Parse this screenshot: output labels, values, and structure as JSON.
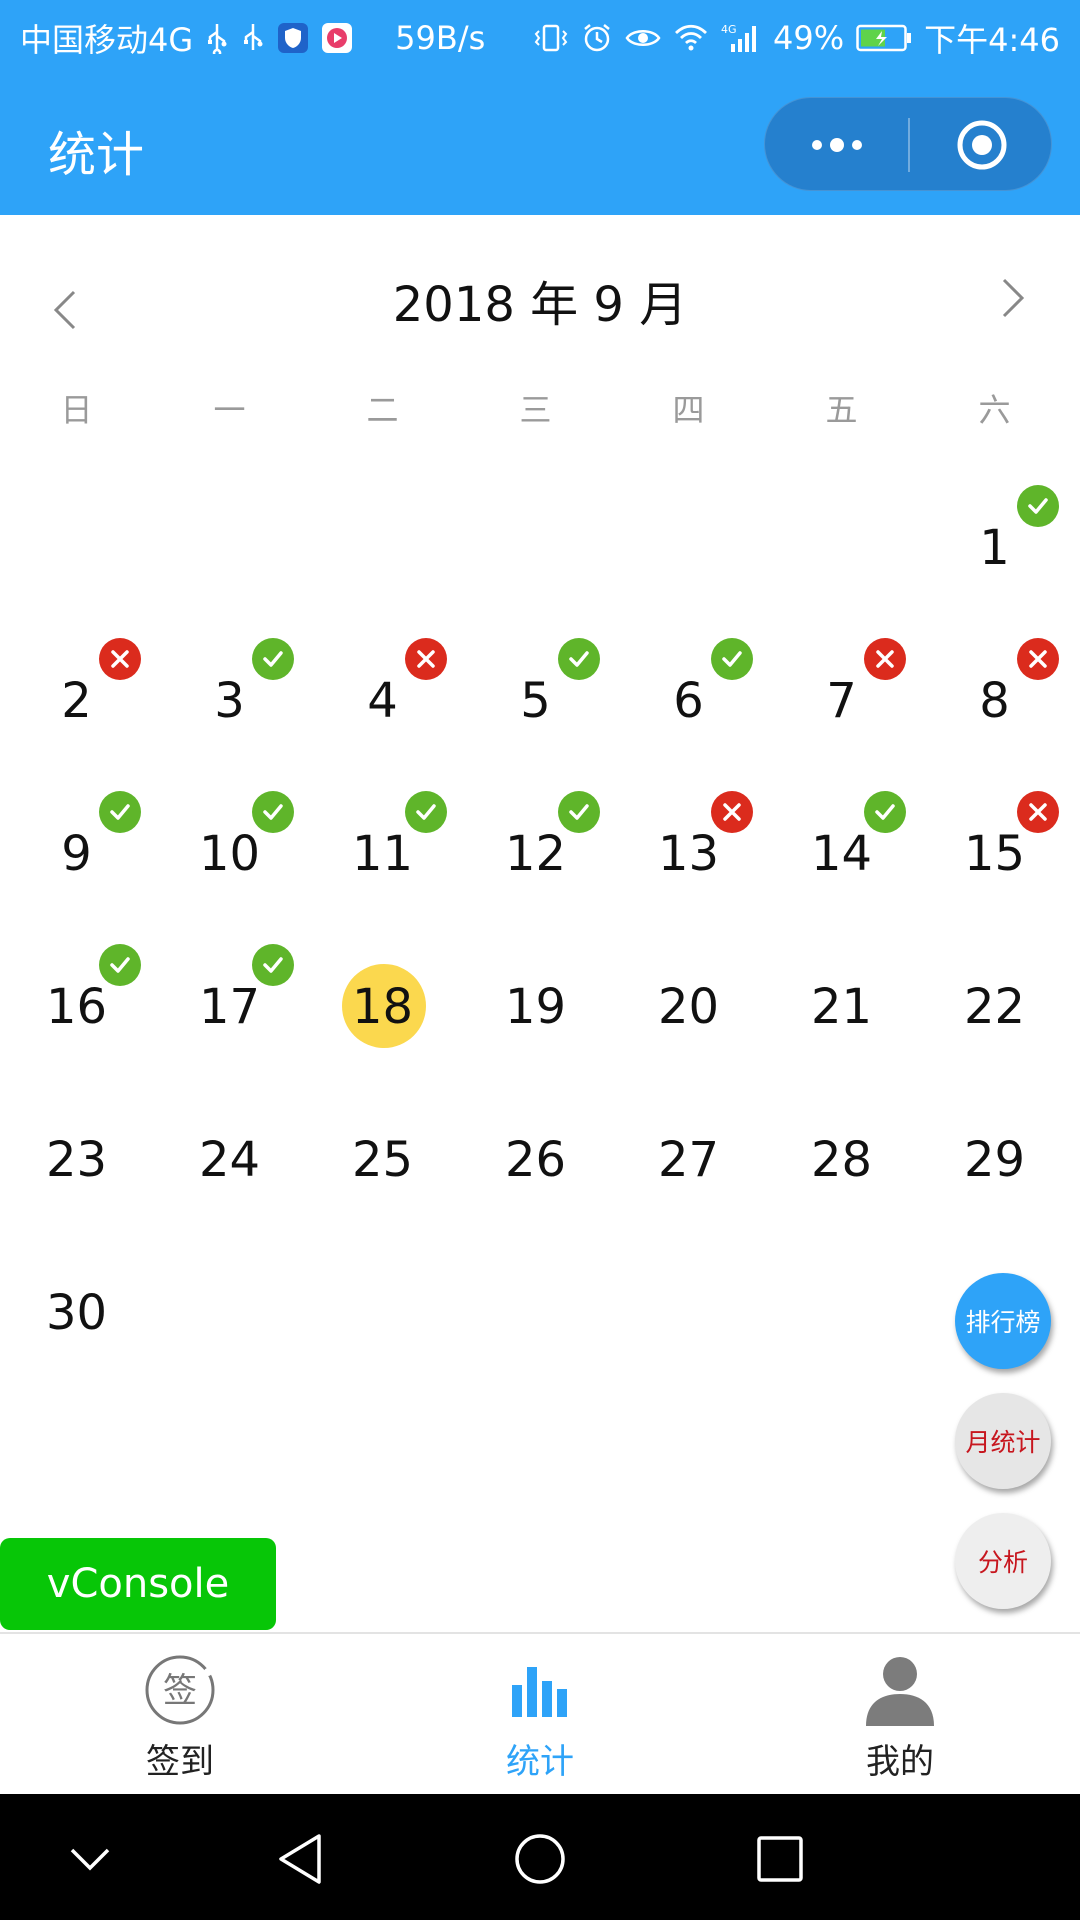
{
  "status_bar": {
    "carrier": "中国移动4G",
    "speed": "59B/s",
    "battery": "49%",
    "time": "下午4:46",
    "network_tag": "4G"
  },
  "navbar": {
    "title": "统计"
  },
  "calendar": {
    "month_title": "2018 年 9 月",
    "weekdays": [
      "日",
      "一",
      "二",
      "三",
      "四",
      "五",
      "六"
    ],
    "today": 18,
    "days": [
      {
        "d": "1",
        "s": "ok"
      },
      {
        "d": "2",
        "s": "miss"
      },
      {
        "d": "3",
        "s": "ok"
      },
      {
        "d": "4",
        "s": "miss"
      },
      {
        "d": "5",
        "s": "ok"
      },
      {
        "d": "6",
        "s": "ok"
      },
      {
        "d": "7",
        "s": "miss"
      },
      {
        "d": "8",
        "s": "miss"
      },
      {
        "d": "9",
        "s": "ok"
      },
      {
        "d": "10",
        "s": "ok"
      },
      {
        "d": "11",
        "s": "ok"
      },
      {
        "d": "12",
        "s": "ok"
      },
      {
        "d": "13",
        "s": "miss"
      },
      {
        "d": "14",
        "s": "ok"
      },
      {
        "d": "15",
        "s": "miss"
      },
      {
        "d": "16",
        "s": "ok"
      },
      {
        "d": "17",
        "s": "ok"
      },
      {
        "d": "18",
        "s": "today"
      },
      {
        "d": "19",
        "s": ""
      },
      {
        "d": "20",
        "s": ""
      },
      {
        "d": "21",
        "s": ""
      },
      {
        "d": "22",
        "s": ""
      },
      {
        "d": "23",
        "s": ""
      },
      {
        "d": "24",
        "s": ""
      },
      {
        "d": "25",
        "s": ""
      },
      {
        "d": "26",
        "s": ""
      },
      {
        "d": "27",
        "s": ""
      },
      {
        "d": "28",
        "s": ""
      },
      {
        "d": "29",
        "s": ""
      },
      {
        "d": "30",
        "s": ""
      }
    ]
  },
  "fabs": {
    "rank": "排行榜",
    "monthly": "月统计",
    "analysis": "分析"
  },
  "vconsole": "vConsole",
  "tabbar": {
    "items": [
      {
        "label": "签到",
        "icon": "sign-in-icon"
      },
      {
        "label": "统计",
        "icon": "bar-chart-icon"
      },
      {
        "label": "我的",
        "icon": "user-icon"
      }
    ],
    "active": 1,
    "sign_glyph": "签"
  },
  "colors": {
    "primary": "#2ea3f8",
    "ok": "#5fb52a",
    "miss": "#db2b1d",
    "today": "#fbd84e",
    "vconsole": "#07c607"
  }
}
